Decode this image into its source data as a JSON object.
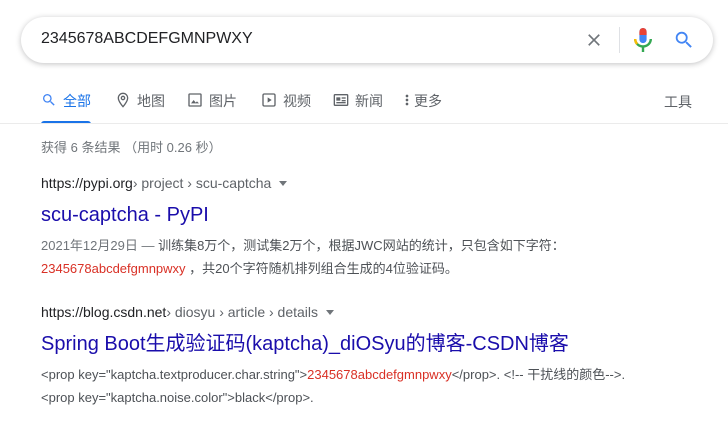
{
  "search": {
    "query": "2345678ABCDEFGMNPWXY"
  },
  "tabs": [
    {
      "label": "全部",
      "icon": "search-icon",
      "active": true
    },
    {
      "label": "地图",
      "icon": "map-pin-icon"
    },
    {
      "label": "图片",
      "icon": "image-icon"
    },
    {
      "label": "视频",
      "icon": "video-icon"
    },
    {
      "label": "新闻",
      "icon": "news-icon"
    },
    {
      "label": "更多",
      "icon": "more-vert-icon"
    }
  ],
  "tools_label": "工具",
  "result_stats": "获得 6 条结果 （用时 0.26 秒）",
  "results": [
    {
      "site": "https://pypi.org",
      "path": " › project › scu-captcha",
      "title": "scu-captcha - PyPI",
      "date": "2021年12月29日 — ",
      "snippet_a": "训练集8万个，测试集2万个，根据JWC网站的统计，只包含如下字符：",
      "snippet_hl": "2345678abcdefgmnpwxy",
      "snippet_b": " ，共20个字符随机排列组合生成的4位验证码。"
    },
    {
      "site": "https://blog.csdn.net",
      "path": " › diosyu › article › details",
      "title": "Spring Boot生成验证码(kaptcha)_diOSyu的博客-CSDN博客",
      "snippet_a": "<prop key=\"kaptcha.textproducer.char.string\">",
      "snippet_hl": "2345678abcdefgmnpwxy",
      "snippet_b": "</prop>. <!-- 干扰线的颜色-->. <prop key=\"kaptcha.noise.color\">black</prop>."
    }
  ],
  "colors": {
    "link": "#1a0dab",
    "accent": "#1a73e8",
    "highlight": "#d93025"
  }
}
